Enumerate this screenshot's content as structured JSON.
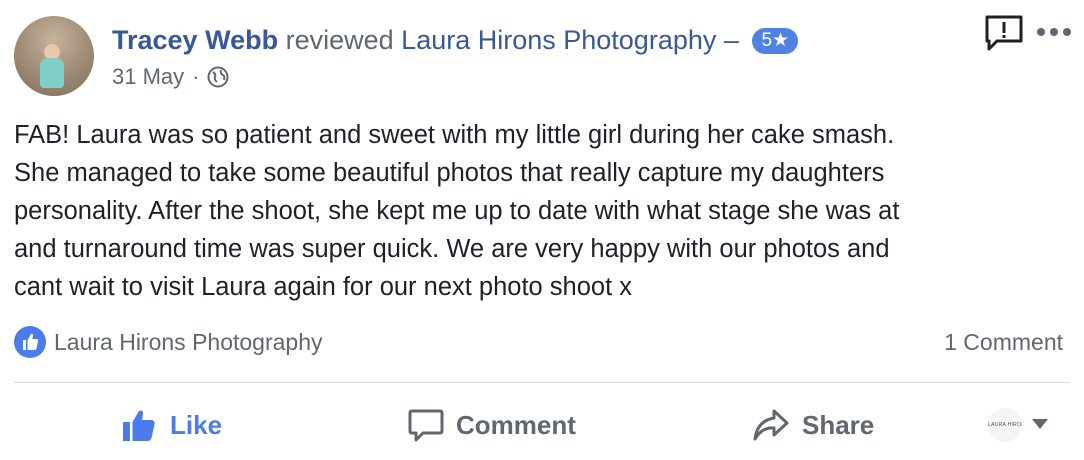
{
  "header": {
    "author": "Tracey Webb",
    "verb": "reviewed",
    "page_name": "Laura Hirons Photography",
    "dash": "–",
    "rating": "5★",
    "date": "31 May",
    "separator": "·",
    "privacy_icon": "globe-icon"
  },
  "review": {
    "text": "FAB! Laura was so patient and sweet with my little girl during her cake smash.\nShe managed to take some beautiful photos that really capture my daughters\npersonality. After the shoot, she kept me up to date with what stage she was at\nand turnaround time was super quick. We are very happy with our photos and\ncant wait to visit Laura again for our next photo shoot x"
  },
  "reactions": {
    "liked_by": "Laura Hirons Photography",
    "comment_count": "1 Comment"
  },
  "actions": {
    "like": "Like",
    "comment": "Comment",
    "share": "Share"
  },
  "audience": {
    "avatar_text": "LAURA HIRONS"
  },
  "colors": {
    "link": "#385898",
    "accent": "#4b7bec",
    "muted": "#606770",
    "badge": "#4f82e3"
  }
}
